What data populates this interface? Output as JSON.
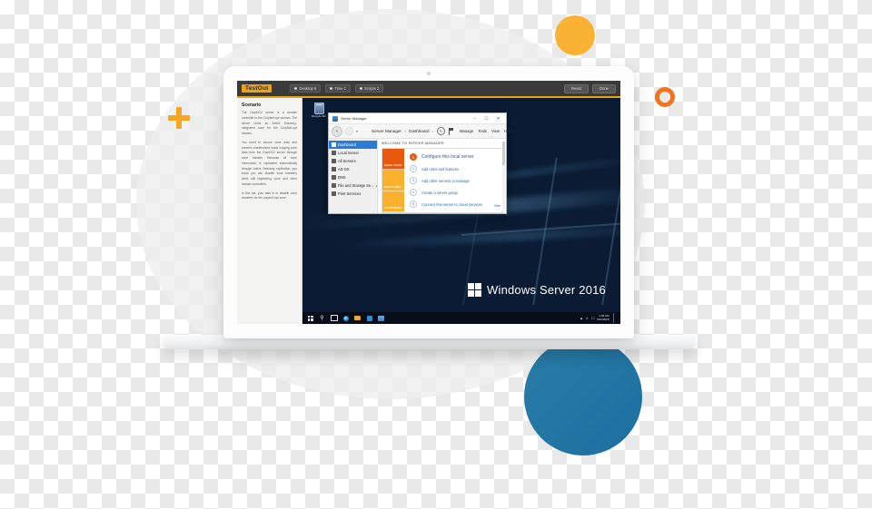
{
  "app": {
    "logo": "TestOut",
    "toolbar": [
      {
        "label": "Desktop 6",
        "icon": "monitor-icon"
      },
      {
        "label": "Time 1",
        "icon": "clock-icon"
      },
      {
        "label": "Scripts 2",
        "icon": "script-icon"
      }
    ],
    "header_buttons": [
      {
        "label": "Reset"
      },
      {
        "label": "Done"
      }
    ]
  },
  "side_panel": {
    "title": "Scenario",
    "paragraphs": [
      "The CorpDC2 server is a domain controller in the CorpNet.xyz domain. The server holds an Active Directory-integrated zone for the CorpNet.xyz domain.",
      "You need to secure zone data and prevent unauthorized hosts copying zone data from the CorpDC2 server through zone transfer. Because all zone information is replicated automatically through Active Directory replication, you know you can disable zone transfers while still registering zone and other domain controllers.",
      "In this lab, your task is to disable zone transfers for the corpnet.xyz zone."
    ]
  },
  "desktop": {
    "recycle_bin_label": "Recycle Bin",
    "branding": "Windows Server 2016",
    "taskbar": {
      "icons": [
        "start-icon",
        "search-icon",
        "task-view-icon",
        "edge-icon",
        "file-explorer-icon",
        "store-icon",
        "server-manager-icon"
      ],
      "tray_icons": [
        "network-icon",
        "volume-icon",
        "action-center-icon"
      ],
      "clock_time": "1:05 AM",
      "clock_date": "5/24/2018"
    }
  },
  "server_manager": {
    "window_title": "Server Manager",
    "window_controls": [
      "minimize",
      "maximize",
      "close"
    ],
    "breadcrumb": {
      "root": "Server Manager",
      "separator": "•",
      "current": "Dashboard"
    },
    "menu": [
      "Manage",
      "Tools",
      "View",
      "Help"
    ],
    "nav_items": [
      {
        "label": "Dashboard",
        "active": true
      },
      {
        "label": "Local Server",
        "active": false
      },
      {
        "label": "All Servers",
        "active": false
      },
      {
        "label": "AD DS",
        "active": false
      },
      {
        "label": "DNS",
        "active": false
      },
      {
        "label": "File and Storage Se...",
        "active": false,
        "expandable": true
      },
      {
        "label": "Print Services",
        "active": false
      }
    ],
    "welcome_heading": "WELCOME TO SERVER MANAGER",
    "tiles": [
      {
        "label": "QUICK START",
        "color": "#e8590c"
      },
      {
        "label": "WHAT'S NEW",
        "color": "#f9b12e"
      },
      {
        "label": "LEARN MORE",
        "color": "#f9b12e"
      }
    ],
    "quick_start": [
      {
        "num": "1",
        "text": "Configure this local server",
        "primary": true
      },
      {
        "num": "2",
        "text": "Add roles and features",
        "primary": false
      },
      {
        "num": "3",
        "text": "Add other servers to manage",
        "primary": false
      },
      {
        "num": "4",
        "text": "Create a server group",
        "primary": false
      },
      {
        "num": "5",
        "text": "Connect this server to cloud services",
        "primary": false
      }
    ],
    "hide_label": "Hide"
  },
  "colors": {
    "brand_gold": "#efa11c",
    "accent_orange": "#e8590c",
    "accent_amber": "#f9b12e",
    "accent_blue": "#2a7bd4",
    "deco_yellow": "#f9b233",
    "deco_orange_ring": "#ee7623",
    "deco_blue_circle": "#2a7ca8"
  }
}
